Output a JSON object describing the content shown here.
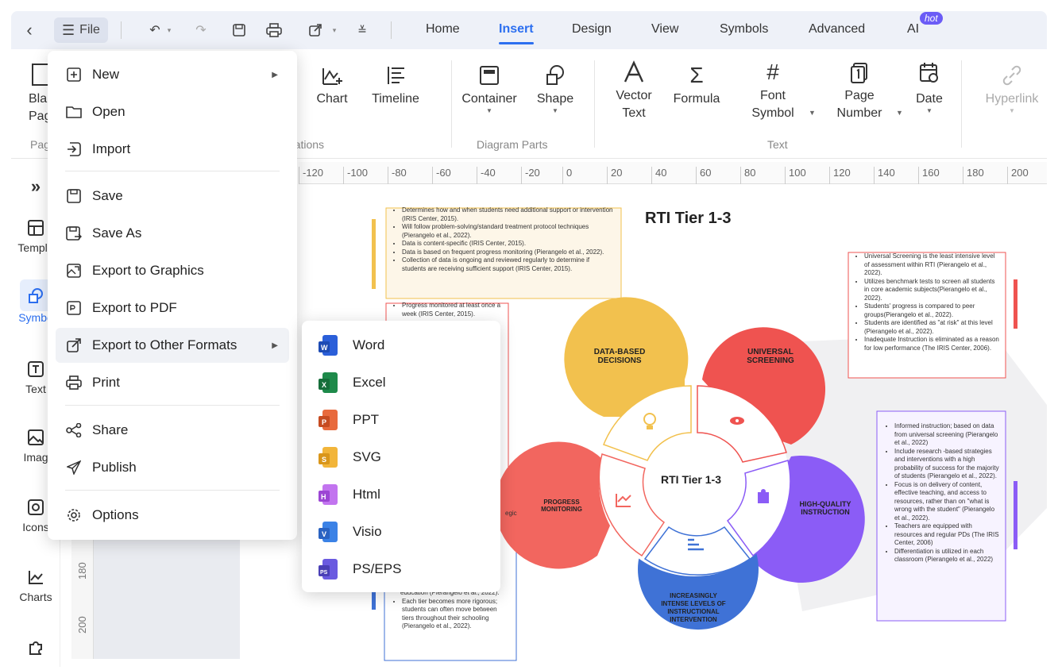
{
  "toolbar": {
    "file_label": "File",
    "tabs": [
      "Home",
      "Insert",
      "Design",
      "View",
      "Symbols",
      "Advanced",
      "AI"
    ],
    "active_tab": "Insert",
    "hot_badge": "hot"
  },
  "ribbon": {
    "items": {
      "blank_page": "Blan\nPag",
      "chart": "Chart",
      "timeline": "Timeline",
      "container": "Container",
      "shape": "Shape",
      "vector_text": "Vector\nText",
      "formula": "Formula",
      "font_symbol": "Font\nSymbol",
      "page_number": "Page\nNumber",
      "date": "Date",
      "hyperlink": "Hyperlink"
    },
    "groups": {
      "pages": "Pag",
      "illustrations": "rations",
      "diagram_parts": "Diagram Parts",
      "text": "Text"
    }
  },
  "left_panel": {
    "items": [
      "Templa",
      "Symbo",
      "Text",
      "Imag",
      "Icons",
      "Charts"
    ]
  },
  "ruler": {
    "top": [
      "-120",
      "-100",
      "-80",
      "-60",
      "-40",
      "-20",
      "0",
      "20",
      "40",
      "60",
      "80",
      "100",
      "120",
      "140",
      "160",
      "180",
      "200"
    ],
    "left": [
      "180",
      "200"
    ]
  },
  "file_menu": {
    "items": [
      "New",
      "Open",
      "Import",
      "Save",
      "Save As",
      "Export to Graphics",
      "Export to PDF",
      "Export to Other Formats",
      "Print",
      "Share",
      "Publish",
      "Options"
    ]
  },
  "export_submenu": {
    "items": [
      "Word",
      "Excel",
      "PPT",
      "SVG",
      "Html",
      "Visio",
      "PS/EPS"
    ],
    "colors": [
      "#2b5fd9",
      "#1e8a4a",
      "#d5522c",
      "#e8a21c",
      "#a34fd6",
      "#2f72d8",
      "#4a3fb6"
    ]
  },
  "diagram": {
    "title": "RTI Tier 1-3",
    "center": "RTI Tier 1-3",
    "petals": [
      "DATA-BASED DECISIONS",
      "UNIVERSAL SCREENING",
      "PROGRESS MONITORING",
      "HIGH-QUALITY INSTRUCTION",
      "INCREASINGLY INTENSE LEVELS OF INSTRUCTIONAL INTERVENTION"
    ],
    "note_yellow": [
      "Determines how and when students need additional support or intervention (IRIS Center, 2015).",
      "Will follow problem-solving/standard treatment protocol techniques (Pierangelo et al., 2022).",
      "Data is content-specific (IRIS Center, 2015).",
      "Data is based on frequent progress monitoring (Pierangelo et al., 2022).",
      "Collection of data is ongoing and reviewed regularly to determine if students are receiving sufficient support (IRIS Center, 2015)."
    ],
    "note_red_left": [
      "Progress monitored at least once a week (IRIS Center, 2015)."
    ],
    "note_red_right": [
      "Universal Screening is the least intensive level of assessment within RTI (Pierangelo et al., 2022).",
      "Utilizes benchmark tests to screen all students in core academic subjects(Pierangelo et al., 2022).",
      "Students' progress is compared to peer groups(Pierangelo et al., 2022).",
      "Students are identified as \"at risk\" at this level (Pierangelo et al., 2022).",
      "Inadequate Instruction is eliminated as a reason for low performance (The IRIS Center, 2006)."
    ],
    "note_purple": [
      "Informed instruction; based on data from universal screening (Pierangelo et al., 2022)",
      "Include research -based strategies and interventions with a high probability of success for the majority of students (Pierangelo et al., 2022).",
      "Focus is on delivery of content, effective teaching, and access to resources, rather than on \"what is wrong with the student\" (Pierangelo et al., 2022).",
      "Teachers are equipped with resources and regular PDs (The IRIS Center, 2006)",
      "Differentiation is utilized in each classroom (Pierangelo et al., 2022)"
    ],
    "note_blue_tail": [
      "education (Pierangelo et al., 2022).",
      "Each tier becomes more rigorous; students can often move between tiers throughout their schooling (Pierangelo et al., 2022)."
    ],
    "frag_egic": "egic",
    "frag_colon": "g:"
  }
}
